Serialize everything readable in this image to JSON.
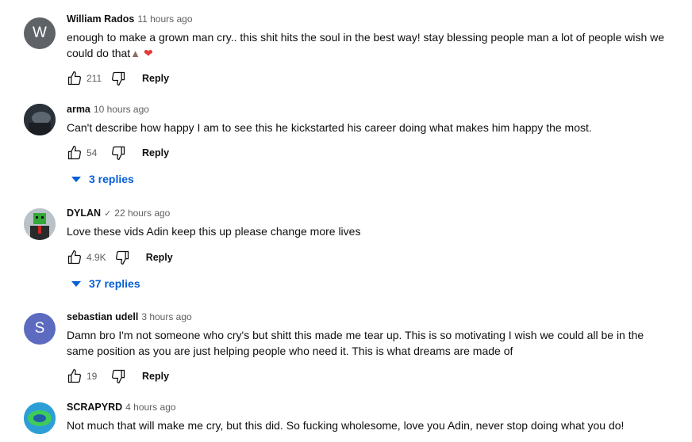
{
  "comments": [
    {
      "author": "William Rados",
      "time": "11 hours ago",
      "avatar_letter": "W",
      "text_line1": "enough to make a grown man cry.. this shit hits the soul in the best way! stay blessing people man a lot of people wish we",
      "text_line2": "could do that",
      "likes": "211",
      "reply_label": "Reply",
      "emoji": [
        "folded-hands",
        "red-heart"
      ]
    },
    {
      "author": "arma",
      "time": "10 hours ago",
      "text_line1": "Can't describe how happy I am to see this he kickstarted his career doing what makes him happy the most.",
      "likes": "54",
      "reply_label": "Reply",
      "replies_label": "3 replies"
    },
    {
      "author": "DYLAN",
      "verified_icon": "checkmark-icon",
      "time": "22 hours ago",
      "text_line1": "Love these vids Adin keep this up please change more lives",
      "likes": "4.9K",
      "reply_label": "Reply",
      "replies_label": "37 replies"
    },
    {
      "author": "sebastian udell",
      "time": "3 hours ago",
      "avatar_letter": "S",
      "text_line1": "Damn bro I'm not someone who cry's but shitt this made me tear up. This is so motivating I wish we could all be in the",
      "text_line2": "same position as you are just helping people who need it. This is what dreams are made of",
      "likes": "19",
      "reply_label": "Reply"
    },
    {
      "author": "SCRAPYRD",
      "time": "4 hours ago",
      "text_line1": "Not much that will make me cry, but this did. So fucking wholesome, love you Adin, never stop doing what you do!"
    }
  ],
  "colors": {
    "link_blue": "#065fd4",
    "secondary_text": "#606060",
    "primary_text": "#0f0f0f",
    "avatar_w": "#5f6368",
    "avatar_s": "#5c6bc0"
  }
}
